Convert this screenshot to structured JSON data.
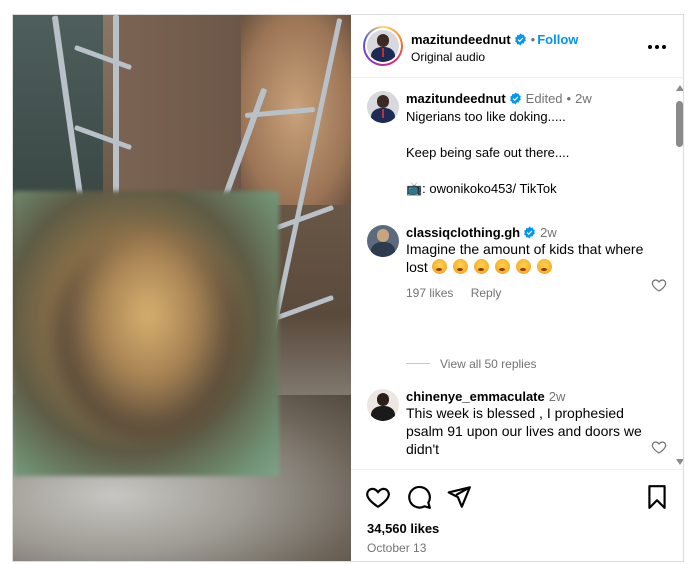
{
  "post": {
    "author": "mazitundeednut",
    "follow_label": "Follow",
    "audio": "Original audio",
    "dot": "•",
    "likes": "34,560 likes",
    "date": "October 13"
  },
  "caption": {
    "author": "mazitundeednut",
    "edited": "Edited",
    "dot": "•",
    "time": "2w",
    "text": "Nigerians too like doking.....\n\nKeep being safe out there....\n\n📺: owonikoko453/ TikTok"
  },
  "comments": [
    {
      "author": "classiqclothing.gh",
      "time": "2w",
      "text": "Imagine the amount of kids that where lost",
      "emoji_count": 6,
      "likes": "197 likes",
      "reply": "Reply",
      "view_replies": "View all 50 replies"
    },
    {
      "author": "chinenye_emmaculate",
      "time": "2w",
      "text": "This week is blessed , I prophesied psalm 91 upon our lives and doors we didn't"
    }
  ],
  "colors": {
    "accent": "#0095f6",
    "muted": "#737373",
    "verified": "#0095f6"
  },
  "icons": [
    "heart-icon",
    "comment-icon",
    "share-icon",
    "bookmark-icon",
    "more-icon",
    "verified-icon"
  ]
}
